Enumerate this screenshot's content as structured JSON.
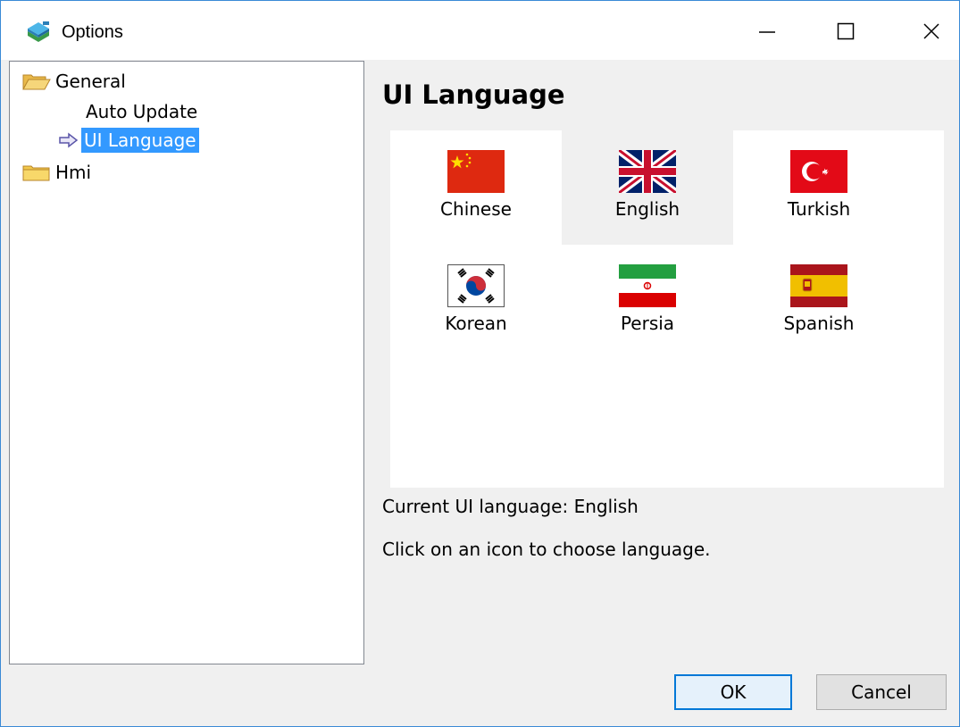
{
  "window": {
    "title": "Options"
  },
  "tree": {
    "items": [
      {
        "label": "General",
        "icon": "folder-open-icon"
      },
      {
        "label": "Auto Update"
      },
      {
        "label": "UI Language",
        "selected": true,
        "icon": "arrow-right-icon"
      },
      {
        "label": "Hmi",
        "icon": "folder-icon"
      }
    ]
  },
  "main": {
    "title": "UI Language",
    "languages": [
      {
        "label": "Chinese",
        "flag": "china-flag-icon"
      },
      {
        "label": "English",
        "flag": "uk-flag-icon",
        "active": true
      },
      {
        "label": "Turkish",
        "flag": "turkey-flag-icon"
      },
      {
        "label": "Korean",
        "flag": "korea-flag-icon"
      },
      {
        "label": "Persia",
        "flag": "iran-flag-icon"
      },
      {
        "label": "Spanish",
        "flag": "spain-flag-icon"
      }
    ],
    "current_language": "Current UI language: English",
    "hint": "Click on an icon to choose language."
  },
  "buttons": {
    "ok": "OK",
    "cancel": "Cancel"
  },
  "colors": {
    "selection": "#3399ff",
    "accent": "#0078d7"
  }
}
